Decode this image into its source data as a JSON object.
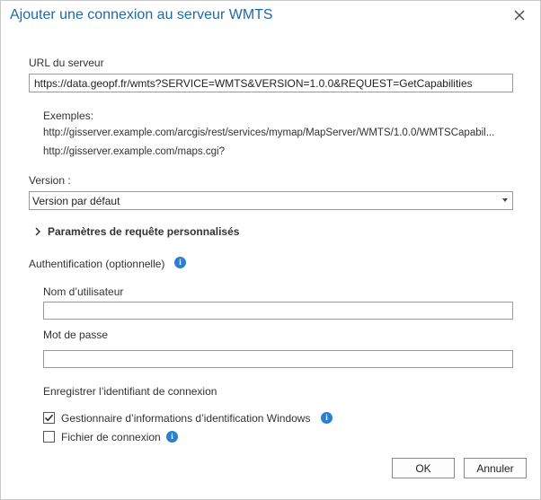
{
  "dialog": {
    "title": "Ajouter une connexion au serveur WMTS"
  },
  "server_url": {
    "label": "URL du serveur",
    "value": "https://data.geopf.fr/wmts?SERVICE=WMTS&VERSION=1.0.0&REQUEST=GetCapabilities"
  },
  "examples": {
    "heading": "Exemples:",
    "items": [
      "http://gisserver.example.com/arcgis/rest/services/mymap/MapServer/WMTS/1.0.0/WMTSCapabil...",
      "http://gisserver.example.com/maps.cgi?"
    ]
  },
  "version": {
    "label": "Version :",
    "selected": "Version par défaut"
  },
  "custom_params": {
    "label": "Paramètres de requête personnalisés",
    "expanded": false
  },
  "auth": {
    "label": "Authentification (optionnelle)",
    "username_label": "Nom d’utilisateur",
    "username_value": "",
    "password_label": "Mot de passe",
    "password_value": "",
    "save_credential_label": "Enregistrer l’identifiant de connexion",
    "options": [
      {
        "label": "Gestionnaire d’informations d’identification Windows",
        "checked": true
      },
      {
        "label": "Fichier de connexion",
        "checked": false
      }
    ]
  },
  "buttons": {
    "ok": "OK",
    "cancel": "Annuler"
  },
  "colors": {
    "title": "#1f6aa5",
    "info_icon": "#2b7fcf"
  }
}
